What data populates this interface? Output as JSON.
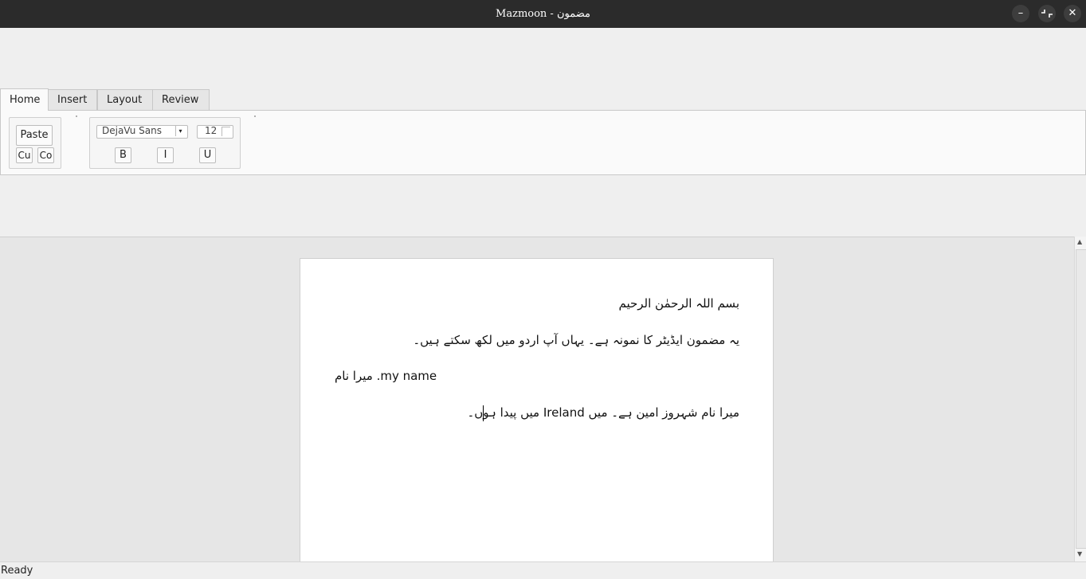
{
  "window": {
    "title": "Mazmoon - مضمون"
  },
  "tabs": [
    "Home",
    "Insert",
    "Layout",
    "Review"
  ],
  "ribbon": {
    "clipboard": {
      "paste": "Paste",
      "cut": "Cu",
      "copy": "Co"
    },
    "font": {
      "family": "DejaVu Sans",
      "size": "12",
      "bold": "B",
      "italic": "I",
      "underline": "U"
    }
  },
  "document": {
    "lines": [
      "بسم اللہ الرحمٰن الرحیم",
      "یہ مضمون ایڈیٹر کا نمونہ ہے۔ یہاں آپ اردو میں لکھ سکتے ہیں۔",
      "my name. میرا نام",
      "میرا نام شہروز امین ہے۔ میں Ireland میں پیدا ہوں۔"
    ]
  },
  "status": {
    "text": "Ready"
  },
  "icons": {
    "minimize": "minimize-icon",
    "restore": "restore-icon",
    "close": "close-icon"
  }
}
